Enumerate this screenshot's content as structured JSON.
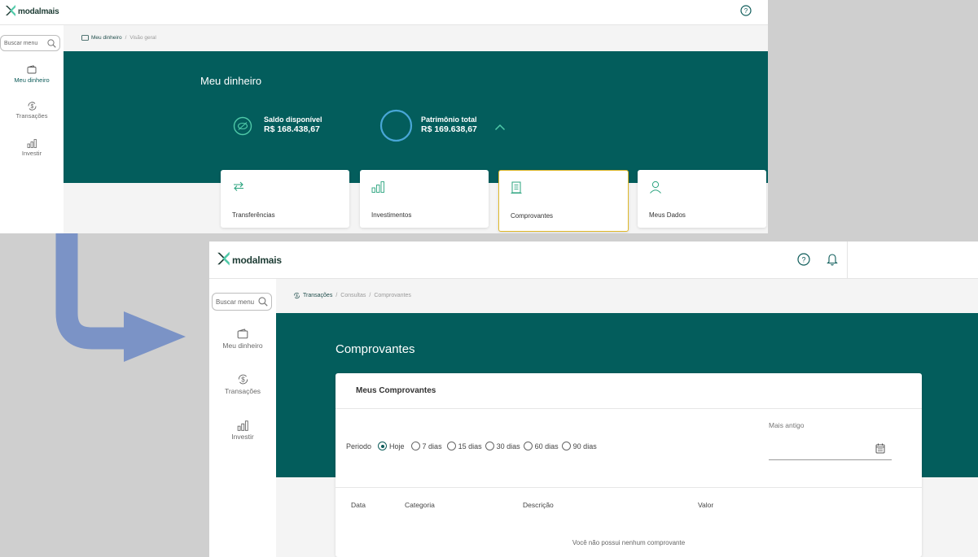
{
  "colors": {
    "brand": "#035d5c",
    "accent": "#4fc9a8",
    "selected_border": "#e0b92a"
  },
  "screen1": {
    "logo_text": "modalmais",
    "help_icon": "question-circle-icon",
    "search_placeholder": "Buscar menu",
    "sidebar": [
      {
        "label": "Meu dinheiro",
        "icon": "wallet-icon",
        "active": true
      },
      {
        "label": "Transações",
        "icon": "dollar-cycle-icon",
        "active": false
      },
      {
        "label": "Investir",
        "icon": "bar-chart-icon",
        "active": false
      }
    ],
    "breadcrumb": [
      "Meu dinheiro",
      "Visão geral"
    ],
    "title": "Meu dinheiro",
    "saldo": {
      "label": "Saldo disponível",
      "value": "R$ 168.438,67"
    },
    "patrimonio": {
      "label": "Patrimônio total",
      "value": "R$ 169.638,67"
    },
    "cards": [
      {
        "label": "Transferências",
        "icon": "transfer-arrows-icon"
      },
      {
        "label": "Investimentos",
        "icon": "bar-chart-icon"
      },
      {
        "label": "Comprovantes",
        "icon": "receipt-icon",
        "selected": true
      },
      {
        "label": "Meus Dados",
        "icon": "user-icon"
      }
    ]
  },
  "screen2": {
    "logo_text": "modalmais",
    "search_placeholder": "Buscar menu",
    "sidebar": [
      {
        "label": "Meu dinheiro",
        "icon": "wallet-icon"
      },
      {
        "label": "Transações",
        "icon": "dollar-cycle-icon"
      },
      {
        "label": "Investir",
        "icon": "bar-chart-icon"
      }
    ],
    "breadcrumb": [
      "Transações",
      "Consultas",
      "Comprovantes"
    ],
    "title": "Comprovantes",
    "panel_title": "Meus Comprovantes",
    "period_label": "Periodo",
    "period_options": [
      "Hoje",
      "7 dias",
      "15 dias",
      "30 dias",
      "60 dias",
      "90 dias"
    ],
    "period_selected": "Hoje",
    "date_field_label": "Mais antigo",
    "columns": [
      "Data",
      "Categoria",
      "Descrição",
      "Valor"
    ],
    "empty_message": "Você não possui nenhum comprovante"
  }
}
